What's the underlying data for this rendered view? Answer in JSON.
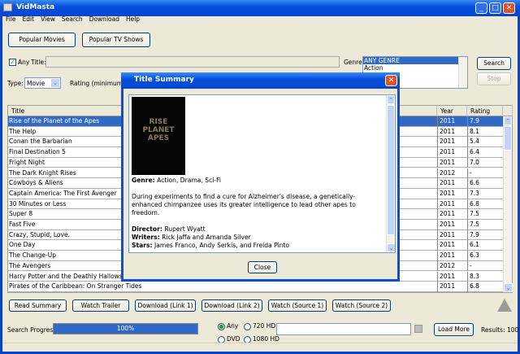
{
  "window": {
    "title": "VidMasta"
  },
  "menu": [
    "File",
    "Edit",
    "View",
    "Search",
    "Download",
    "Help"
  ],
  "top_buttons": {
    "popular_movies": "Popular Movies",
    "popular_tv": "Popular TV Shows"
  },
  "search": {
    "any_label": "Any",
    "title_label": "Title:",
    "title_value": "",
    "genre_label": "Genre:",
    "genres": [
      "ANY GENRE",
      "Action"
    ],
    "search_button": "Search",
    "stop_button": "Stop",
    "type_label": "Type:",
    "type_value": "Movie",
    "rating_label": "Rating (minimum):"
  },
  "table": {
    "columns": [
      "Title",
      "Year",
      "Rating"
    ],
    "rows": [
      {
        "title": "Rise of the Planet of the Apes",
        "year": "2011",
        "rating": "7.9"
      },
      {
        "title": "The Help",
        "year": "2011",
        "rating": "8.1"
      },
      {
        "title": "Conan the Barbarian",
        "year": "2011",
        "rating": "5.4"
      },
      {
        "title": "Final Destination 5",
        "year": "2011",
        "rating": "6.4"
      },
      {
        "title": "Fright Night",
        "year": "2011",
        "rating": "7.0"
      },
      {
        "title": "The Dark Knight Rises",
        "year": "2012",
        "rating": "-"
      },
      {
        "title": "Cowboys & Aliens",
        "year": "2011",
        "rating": "6.6"
      },
      {
        "title": "Captain America: The First Avenger",
        "year": "2011",
        "rating": "7.3"
      },
      {
        "title": "30 Minutes or Less",
        "year": "2011",
        "rating": "6.8"
      },
      {
        "title": "Super 8",
        "year": "2011",
        "rating": "7.5"
      },
      {
        "title": "Fast Five",
        "year": "2011",
        "rating": "7.5"
      },
      {
        "title": "Crazy, Stupid, Love.",
        "year": "2011",
        "rating": "7.9"
      },
      {
        "title": "One Day",
        "year": "2011",
        "rating": "6.1"
      },
      {
        "title": "The Change-Up",
        "year": "2011",
        "rating": "6.3"
      },
      {
        "title": "The Avengers",
        "year": "2012",
        "rating": "-"
      },
      {
        "title": "Harry Potter and the Deathly Hallows: Part 2",
        "year": "2011",
        "rating": "8.3"
      },
      {
        "title": "Pirates of the Caribbean: On Stranger Tides",
        "year": "2011",
        "rating": "6.8"
      }
    ]
  },
  "dialog": {
    "title": "Title Summary",
    "poster_text": "RISE OF THE PLANET OF THE APES",
    "genre_label": "Genre:",
    "genre": "Action, Drama, Sci-Fi",
    "plot": "During experiments to find a cure for Alzheimer's disease, a genetically-enhanced chimpanzee uses its greater intelligence to lead other apes to freedom.",
    "director_label": "Director:",
    "director": "Rupert Wyatt",
    "writers_label": "Writers:",
    "writers": "Rick Jaffa and Amanda Silver",
    "stars_label": "Stars:",
    "stars": "James Franco, Andy Serkis, and Freida Pinto",
    "close_button": "Close"
  },
  "actions": [
    "Read Summary",
    "Watch Trailer",
    "Download (Link 1)",
    "Download (Link 2)",
    "Watch (Source 1)",
    "Watch (Source 2)"
  ],
  "bottom": {
    "progress_label": "Search Progress:",
    "progress_text": "100%",
    "progress_percent": 100,
    "radios": [
      {
        "label": "Any",
        "checked": true
      },
      {
        "label": "720 HD",
        "checked": false
      },
      {
        "label": "DVD",
        "checked": false
      },
      {
        "label": "1080 HD",
        "checked": false
      }
    ],
    "load_more": "Load More",
    "results": "Results: 100"
  }
}
